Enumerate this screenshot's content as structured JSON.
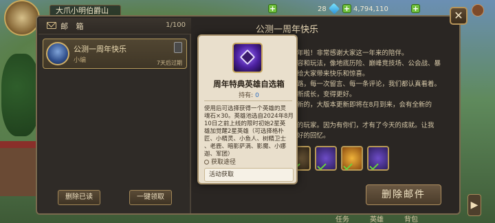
{
  "topbar": {
    "player_name": "大爪小明伯爵山",
    "level_value": "28",
    "gold_value": "4,794,110"
  },
  "mail_panel": {
    "title": "邮 箱",
    "count": "1/100",
    "items": [
      {
        "subject": "公测一周年快乐",
        "sender": "小编",
        "expire": "7天后过期"
      }
    ],
    "delete_read_label": "删除已读",
    "claim_all_label": "一键领取"
  },
  "detail": {
    "title": "公测一周年快乐",
    "lines": [
      "年啦！非常感谢大家这一年来的陪伴。",
      "容和玩法，像地底历险、巅峰竞技场、公会战、暴",
      "给大家带来快乐和惊喜。",
      "路，每一次留言、每一条评论，我们都认真看着。",
      "断成长，变得更好。",
      "新的，大版本更新即将在8月到来，会有全新的",
      "",
      "的玩家。因为有你们，才有了今天的成就。让我",
      "好的回忆。"
    ],
    "delete_mail_label": "删除邮件",
    "bottom_tabs": [
      "任务",
      "英雄",
      "背包"
    ]
  },
  "popup": {
    "title": "周年特典英雄自选箱",
    "own_label": "持有:",
    "own_count": "0",
    "desc_lines": [
      "使用后可选择获得一个英雄的灵",
      "魂石×30。英雄池选自2024年8月",
      "10日之前上线的限时初始2星英",
      "雄加觉醒2星英雄（可选择格朴",
      "匠、小精灵、小鱼人、树精卫士",
      "、老鹿、暗影萨满、影魔、小娜",
      "迦、军团）"
    ],
    "source_title": "获取途径",
    "source_item": "活动获取"
  },
  "colors": {
    "accent_gold": "#b59a5c",
    "panel_bg": "#2a2623",
    "popup_bg": "#e9dfcc",
    "check_green": "#69d23c"
  },
  "icons": [
    "mail-icon",
    "close-icon",
    "gem-icon",
    "plus-icon",
    "chest-icon",
    "search-icon",
    "check-icon",
    "chevron-right-icon"
  ]
}
